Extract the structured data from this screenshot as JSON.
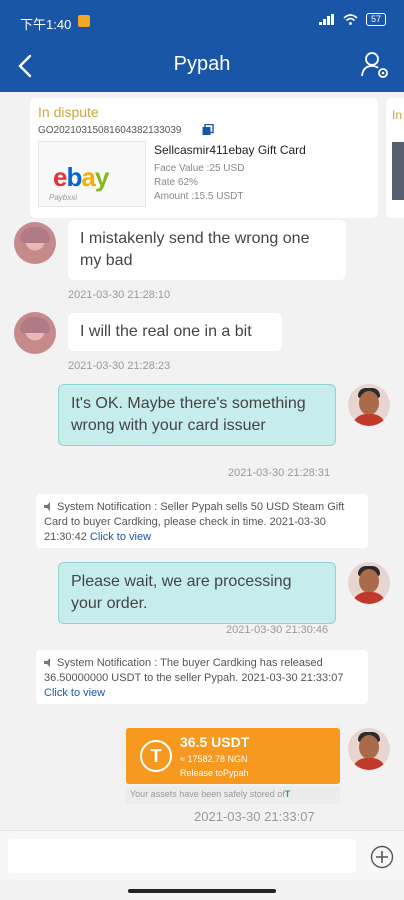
{
  "status_bar": {
    "time": "下午1:40",
    "battery": "57"
  },
  "header": {
    "title": "Pypah"
  },
  "order": {
    "status": "In dispute",
    "order_id": "GO2021031508160438213303​9",
    "logo_text": "ebay",
    "logo_sub": "Paybxxi",
    "product_name": "Sellcasmir411ebay Gift Card",
    "face_value": "Face Value :25 USD",
    "rate": "Rate 62%",
    "amount": "Amount :15.5 USDT",
    "colors": {
      "status": "#c9a83a",
      "logo_e": "#e53238",
      "logo_b": "#0064d2",
      "logo_a": "#f5af02",
      "logo_y": "#86b817"
    }
  },
  "peek_order": {
    "status": "In"
  },
  "messages": [
    {
      "side": "in",
      "text": "I mistakenly send the wrong one my bad",
      "time": "2021-03-30 21:28:10"
    },
    {
      "side": "in",
      "text": "I will the real one in a bit",
      "time": "2021-03-30 21:28:23"
    },
    {
      "side": "out",
      "text": "It's OK. Maybe there's something wrong with your card issuer",
      "time": "2021-03-30 21:28:31"
    },
    {
      "side": "system",
      "text": "System Notification : Seller Pypah sells 50 USD Steam Gift Card to buyer Cardking, please check in time. 2021-03-30 21:30:42",
      "link": "Click to view"
    },
    {
      "side": "out",
      "text": "Please wait, we are processing your order.",
      "time": "2021-03-30 21:30:46"
    },
    {
      "side": "system",
      "text": "System Notification : The buyer Cardking has released 36.50000000 USDT to the seller Pypah. 2021-03-30 21:33:07",
      "link": "Click to view"
    }
  ],
  "transfer": {
    "amount": "36.5 USDT",
    "ngn": "≈ 17582.78 NGN",
    "release": "Release toPypah",
    "footer": "Your assets have been safely stored of",
    "time": "2021-03-30 21:33:07",
    "accent": "#f7991f"
  },
  "composer": {
    "placeholder": ""
  }
}
